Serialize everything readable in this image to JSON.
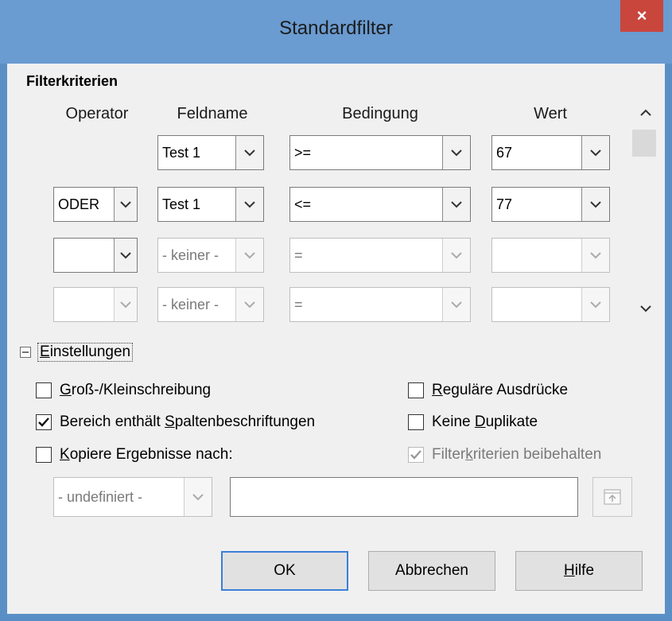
{
  "window": {
    "title": "Standardfilter",
    "close_symbol": "×"
  },
  "criteria": {
    "label": "Filterkriterien",
    "columns": {
      "operator": "Operator",
      "fieldname": "Feldname",
      "condition": "Bedingung",
      "value": "Wert"
    },
    "rows": [
      {
        "operator": "",
        "fieldname": "Test 1",
        "condition": ">=",
        "value": "67"
      },
      {
        "operator": "ODER",
        "fieldname": "Test 1",
        "condition": "<=",
        "value": "77"
      },
      {
        "operator": "",
        "fieldname": "- keiner -",
        "condition": "=",
        "value": ""
      },
      {
        "operator": "",
        "fieldname": "- keiner -",
        "condition": "=",
        "value": ""
      }
    ]
  },
  "options": {
    "toggle_symbol": "−",
    "label_prefix": "",
    "label_accel": "E",
    "label_rest": "instellungen",
    "case_sensitive": {
      "accel": "G",
      "rest": "roß-/Kleinschreibung",
      "checked": false
    },
    "regex": {
      "accel": "R",
      "rest": "eguläre Ausdrücke",
      "checked": false
    },
    "headers": {
      "before": "Bereich enthält ",
      "accel": "S",
      "rest": "paltenbeschriftungen",
      "checked": true
    },
    "no_duplicates": {
      "before": "Keine ",
      "accel": "D",
      "rest": "uplikate",
      "checked": false
    },
    "copy_results": {
      "accel": "K",
      "rest": "opiere Ergebnisse nach:",
      "checked": false
    },
    "keep_filter": {
      "before": "Filter",
      "accel": "k",
      "rest": "riterien beibehalten",
      "checked": true
    },
    "copy_target_select": "- undefiniert -",
    "copy_target_input": ""
  },
  "buttons": {
    "ok": "OK",
    "cancel": "Abbrechen",
    "help_accel": "H",
    "help_rest": "ilfe"
  }
}
